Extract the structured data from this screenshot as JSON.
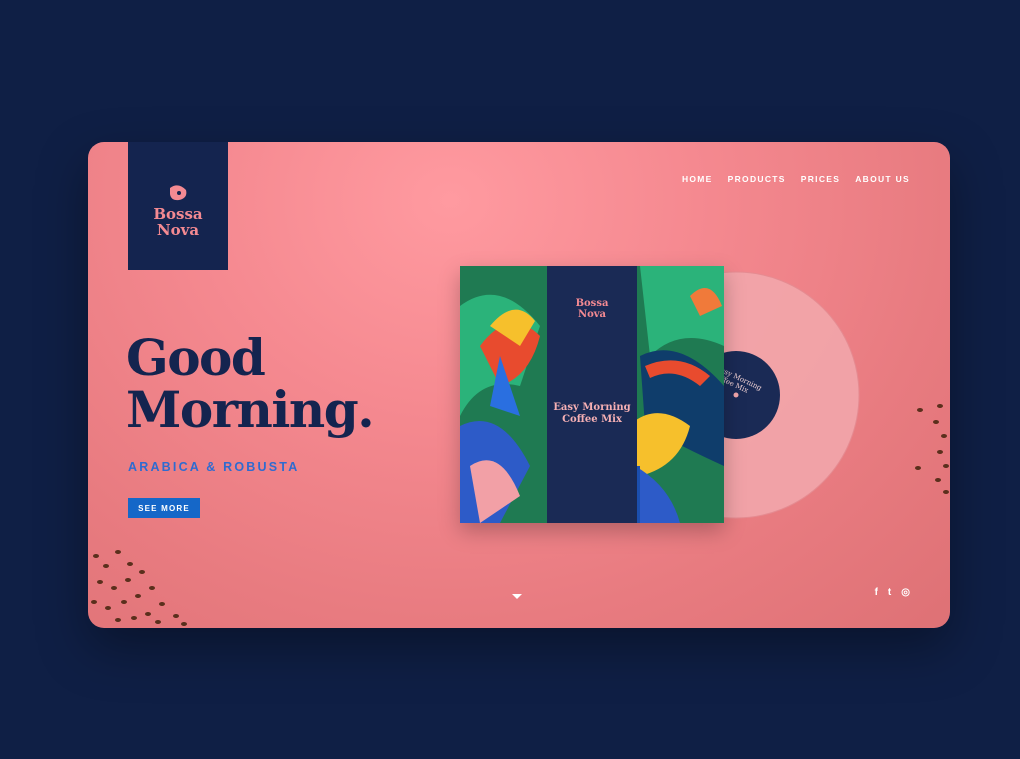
{
  "brand": {
    "name_line1": "Bossa",
    "name_line2": "Nova"
  },
  "nav": {
    "items": [
      {
        "label": "HOME"
      },
      {
        "label": "PRODUCTS"
      },
      {
        "label": "PRICES"
      },
      {
        "label": "ABOUT US"
      }
    ]
  },
  "hero": {
    "headline_line1": "Good",
    "headline_line2": "Morning.",
    "subheading": "ARABICA & ROBUSTA",
    "cta_label": "SEE MORE"
  },
  "album": {
    "brand_line1": "Bossa",
    "brand_line2": "Nova",
    "title_line1": "Easy Morning",
    "title_line2": "Coffee Mix",
    "vinyl_label": "Easy Morning Coffee Mix"
  },
  "social": {
    "facebook_glyph": "f",
    "twitter_glyph": "t",
    "instagram_glyph": "◎"
  },
  "colors": {
    "background": "#0f1f45",
    "card": "#f58990",
    "navy": "#14244f",
    "accent_blue": "#1567c8",
    "pink": "#f48a92"
  },
  "icons": [
    "logo-mark-icon",
    "chevron-down-icon",
    "facebook-icon",
    "twitter-icon",
    "instagram-icon"
  ]
}
